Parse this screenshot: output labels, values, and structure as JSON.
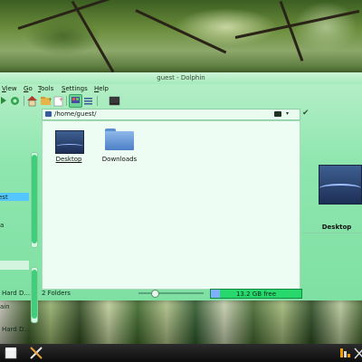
{
  "window": {
    "title": "guest - Dolphin"
  },
  "menu": [
    {
      "label": "View",
      "u": "V",
      "rest": "iew"
    },
    {
      "label": "Go",
      "u": "G",
      "rest": "o"
    },
    {
      "label": "Tools",
      "u": "T",
      "rest": "ools"
    },
    {
      "label": "Settings",
      "u": "S",
      "rest": "ettings"
    },
    {
      "label": "Help",
      "u": "H",
      "rest": "elp"
    }
  ],
  "toolbar": {
    "icons": [
      "back-icon",
      "reload-icon",
      "home-icon",
      "new-folder-icon",
      "new-file-icon",
      "icon-view-icon",
      "details-view-icon",
      "terminal-icon"
    ],
    "active": "icon-view-icon"
  },
  "location": {
    "path": "/home/guest/"
  },
  "places": {
    "items": [
      {
        "label": "est",
        "selected": true
      },
      {
        "label": "a",
        "selected": false
      },
      {
        "label": "lain",
        "selected": false
      },
      {
        "label": "Hard D...",
        "selected": false
      }
    ]
  },
  "files": [
    {
      "name": "Desktop",
      "icon": "desktop-thumb-icon"
    },
    {
      "name": "Downloads",
      "icon": "folder-icon"
    }
  ],
  "info": {
    "name": "Desktop"
  },
  "status": {
    "count_text": "2 Folders",
    "free_text": "13.2 GB free",
    "zoom_level": 0.24,
    "used_fraction": 0.1
  },
  "taskbar": {
    "icons": [
      "new-window-icon",
      "tools-icon",
      "app-launcher-icon",
      "clipboard-icon"
    ]
  },
  "colors": {
    "window_bg": "#8ee6ae",
    "selection": "#55c6ff",
    "space_bar": "#27d96c",
    "taskbar": "#1a1a1a"
  }
}
